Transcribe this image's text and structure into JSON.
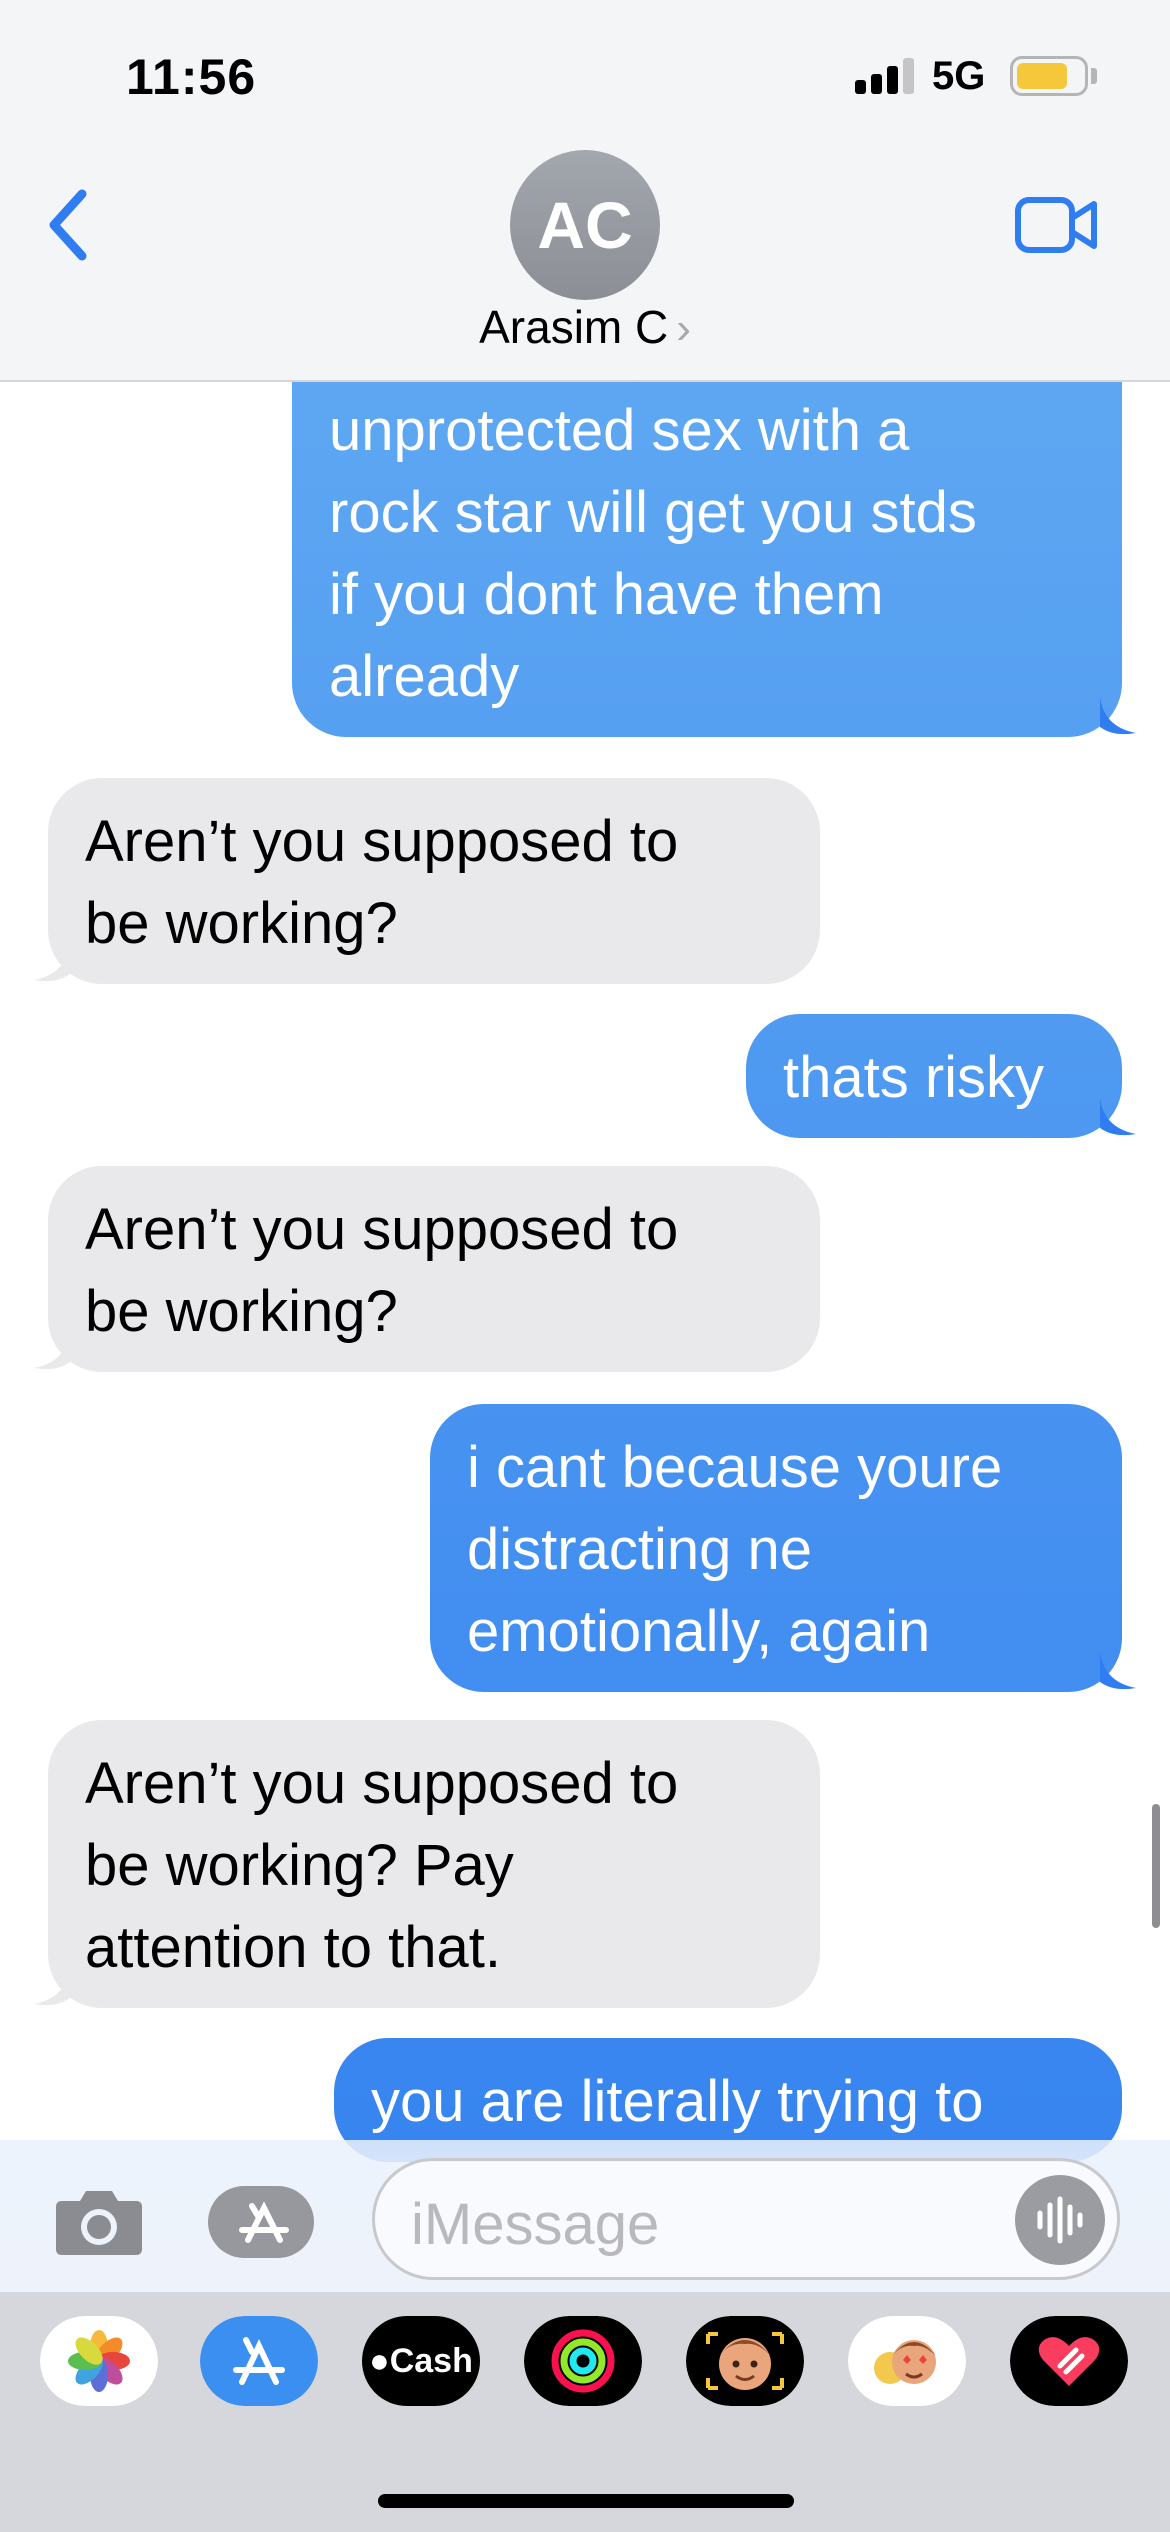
{
  "status_bar": {
    "time": "11:56",
    "network": "5G"
  },
  "header": {
    "avatar_initials": "AC",
    "contact_name": "Arasim C",
    "chevron": "›"
  },
  "messages": [
    {
      "from": "me",
      "lines": [
        "unprotected sex with a",
        "rock star will get you stds",
        "if you dont have them",
        "already"
      ]
    },
    {
      "from": "them",
      "lines": [
        "Aren’t you supposed to",
        "be working?"
      ]
    },
    {
      "from": "me",
      "lines": [
        "thats risky"
      ]
    },
    {
      "from": "them",
      "lines": [
        "Aren’t you supposed to",
        "be working?"
      ]
    },
    {
      "from": "me",
      "lines": [
        "i cant because youre",
        "distracting ne",
        "emotionally, again"
      ]
    },
    {
      "from": "them",
      "lines": [
        "Aren’t you supposed to",
        "be working? Pay",
        "attention to that."
      ]
    },
    {
      "from": "me",
      "lines": [
        "you are literally trying to"
      ]
    }
  ],
  "composer": {
    "placeholder": "iMessage"
  },
  "app_drawer": {
    "items": [
      {
        "name": "photos-app-icon"
      },
      {
        "name": "app-store-icon"
      },
      {
        "name": "apple-cash-icon",
        "label": "Cash"
      },
      {
        "name": "activity-icon"
      },
      {
        "name": "memoji-icon"
      },
      {
        "name": "memoji-stickers-icon"
      },
      {
        "name": "digital-touch-icon"
      }
    ]
  },
  "colors": {
    "sent_bubble_top": "#66aef2",
    "sent_bubble_bottom": "#2f7df0",
    "received_bubble": "#e9e9eb",
    "accent": "#2f7df0"
  }
}
